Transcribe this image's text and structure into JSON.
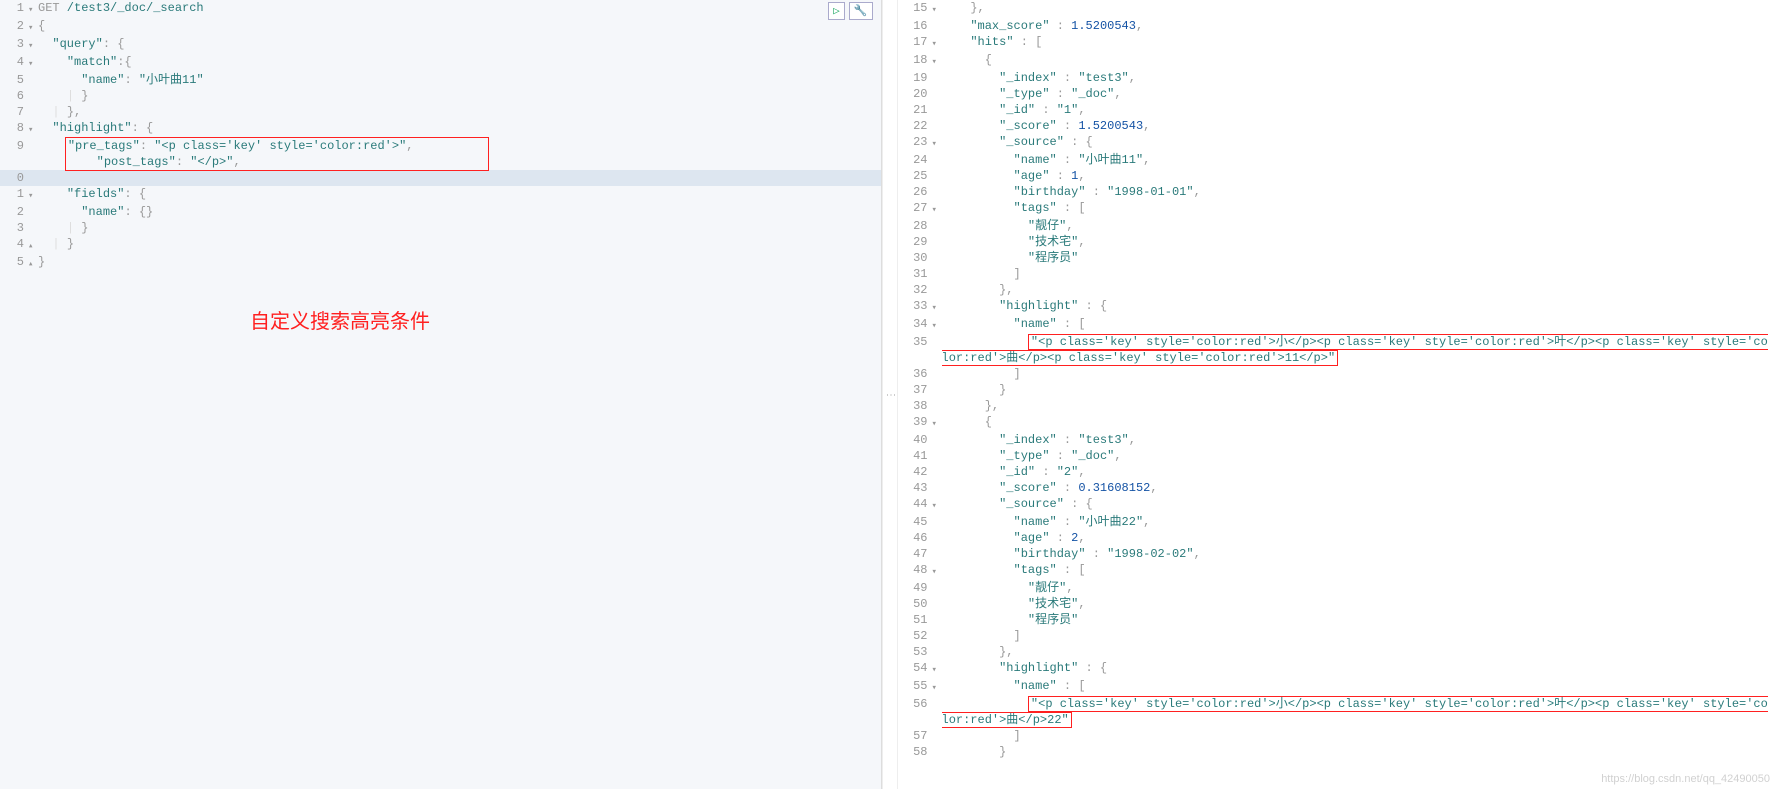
{
  "left": {
    "method": "GET",
    "url": "/test3/_doc/_search",
    "lines": {
      "l1_method": "GET",
      "l1_url": " /test3/_doc/_search",
      "l2": "{",
      "l3_k": "\"query\"",
      "l3_v": ": {",
      "l4_k": "\"match\"",
      "l4_v": ":{",
      "l5_k": "\"name\"",
      "l5_v": ": ",
      "l5_s": "\"小叶曲11\"",
      "l6": "}",
      "l7": "},",
      "l8_k": "\"highlight\"",
      "l8_v": ": {",
      "l9_k": "\"pre_tags\"",
      "l9_v": ": ",
      "l9_s": "\"<p class='key' style='color:red'>\"",
      "l9_c": ",",
      "l10_k": "\"post_tags\"",
      "l10_v": ": ",
      "l10_s": "\"</p>\"",
      "l10_c": ",",
      "l11_k": "\"fields\"",
      "l11_v": ": {",
      "l12_k": "\"name\"",
      "l12_v": ": {}",
      "l13": "}",
      "l14": "}",
      "l15": "}"
    },
    "annotation": "自定义搜索高亮条件"
  },
  "right": {
    "lines": {
      "r15": "},",
      "r16_k": "\"max_score\"",
      "r16_v": " : ",
      "r16_n": "1.5200543",
      "r16_c": ",",
      "r17_k": "\"hits\"",
      "r17_v": " : [",
      "r18": "{",
      "r19_k": "\"_index\"",
      "r19_s": "\"test3\"",
      "r20_k": "\"_type\"",
      "r20_s": "\"_doc\"",
      "r21_k": "\"_id\"",
      "r21_s": "\"1\"",
      "r22_k": "\"_score\"",
      "r22_n": "1.5200543",
      "r23_k": "\"_source\"",
      "r23_v": " : {",
      "r24_k": "\"name\"",
      "r24_s": "\"小叶曲11\"",
      "r25_k": "\"age\"",
      "r25_n": "1",
      "r26_k": "\"birthday\"",
      "r26_s": "\"1998-01-01\"",
      "r27_k": "\"tags\"",
      "r27_v": " : [",
      "r28_s": "\"靓仔\"",
      "r29_s": "\"技术宅\"",
      "r30_s": "\"程序员\"",
      "r31": "]",
      "r32": "},",
      "r33_k": "\"highlight\"",
      "r33_v": " : {",
      "r34_k": "\"name\"",
      "r34_v": " : [",
      "r35_s": "\"<p class='key' style='color:red'>小</p><p class='key' style='color:red'>叶</p><p class='key' style='color:red'>曲</p><p class='key' style='color:red'>11</p>\"",
      "r36": "]",
      "r37": "}",
      "r38": "},",
      "r39": "{",
      "r40_k": "\"_index\"",
      "r40_s": "\"test3\"",
      "r41_k": "\"_type\"",
      "r41_s": "\"_doc\"",
      "r42_k": "\"_id\"",
      "r42_s": "\"2\"",
      "r43_k": "\"_score\"",
      "r43_n": "0.31608152",
      "r44_k": "\"_source\"",
      "r44_v": " : {",
      "r45_k": "\"name\"",
      "r45_s": "\"小叶曲22\"",
      "r46_k": "\"age\"",
      "r46_n": "2",
      "r47_k": "\"birthday\"",
      "r47_s": "\"1998-02-02\"",
      "r48_k": "\"tags\"",
      "r48_v": " : [",
      "r49_s": "\"靓仔\"",
      "r50_s": "\"技术宅\"",
      "r51_s": "\"程序员\"",
      "r52": "]",
      "r53": "},",
      "r54_k": "\"highlight\"",
      "r54_v": " : {",
      "r55_k": "\"name\"",
      "r55_v": " : [",
      "r56_s": "\"<p class='key' style='color:red'>小</p><p class='key' style='color:red'>叶</p><p class='key' style='color:red'>曲</p>22\"",
      "r57": "]",
      "r58": "}"
    }
  },
  "toolbar": {
    "play": "▷",
    "wrench": "🔧"
  },
  "watermark": "https://blog.csdn.net/qq_42490050"
}
